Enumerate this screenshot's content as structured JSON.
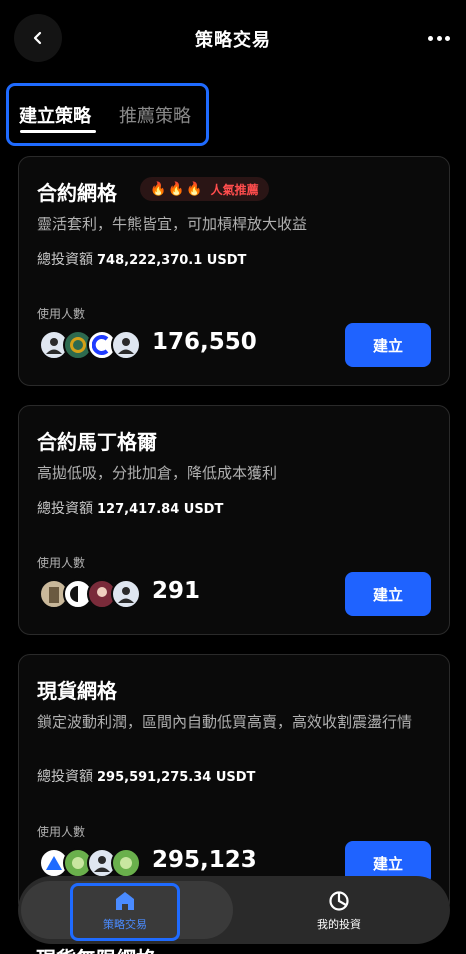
{
  "header": {
    "title": "策略交易"
  },
  "tabs": [
    {
      "label": "建立策略",
      "active": true
    },
    {
      "label": "推薦策略",
      "active": false
    }
  ],
  "cards": [
    {
      "title": "合約網格",
      "badge": "人氣推薦",
      "description": "靈活套利，牛熊皆宜，可加槓桿放大收益",
      "invest_label": "總投資額",
      "invest_amount": "748,222,370.1 USDT",
      "users_label": "使用人數",
      "user_count": "176,550",
      "button": "建立"
    },
    {
      "title": "合約馬丁格爾",
      "description": "高拋低吸，分批加倉，降低成本獲利",
      "invest_label": "總投資額",
      "invest_amount": "127,417.84 USDT",
      "users_label": "使用人數",
      "user_count": "291",
      "button": "建立"
    },
    {
      "title": "現貨網格",
      "description": "鎖定波動利潤，區間內自動低買高賣，高效收割震盪行情",
      "invest_label": "總投資額",
      "invest_amount": "295,591,275.34 USDT",
      "users_label": "使用人數",
      "user_count": "295,123",
      "button": "建立"
    }
  ],
  "peek_title": "現貨無限網格",
  "bottom_nav": [
    {
      "label": "策略交易",
      "icon": "home-icon",
      "active": true
    },
    {
      "label": "我的投資",
      "icon": "pie-chart-icon",
      "active": false
    }
  ],
  "colors": {
    "accent": "#1f63ff",
    "hot": "#ff4d4d"
  }
}
